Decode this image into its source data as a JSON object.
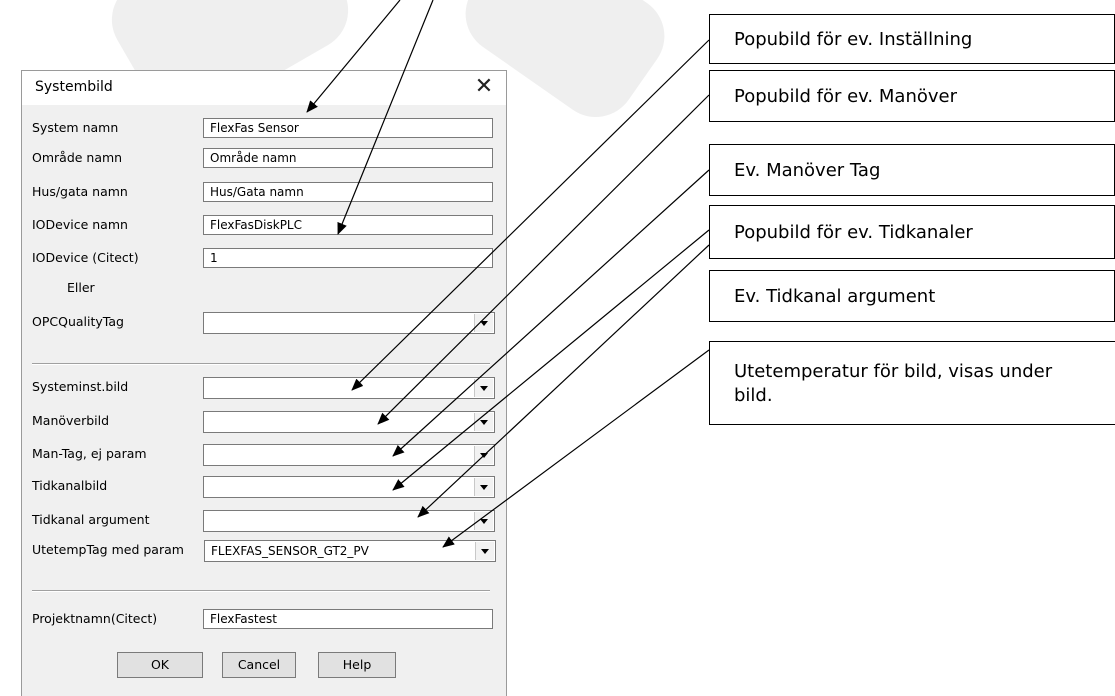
{
  "dialog": {
    "title": "Systembild",
    "close_glyph": "✕",
    "labels": {
      "system_name": "System namn",
      "area_name": "Område namn",
      "building_name": "Hus/gata namn",
      "iodevice_name": "IODevice namn",
      "iodevice_citect": "IODevice (Citect)",
      "or": "Eller",
      "opc_quality_tag": "OPCQualityTag",
      "settings_image": "Systeminst.bild",
      "maneuver_image": "Manöverbild",
      "maneuver_tag": "Man-Tag, ej param",
      "timechannel_image": "Tidkanalbild",
      "timechannel_arg": "Tidkanal argument",
      "outdoor_temp_tag": "UtetempTag med param",
      "project_name": "Projektnamn(Citect)"
    },
    "values": {
      "system_name": "FlexFas Sensor",
      "area_name": "Område namn",
      "building_name": "Hus/Gata namn",
      "iodevice_name": "FlexFasDiskPLC",
      "iodevice_citect": "1",
      "opc_quality_tag": "",
      "settings_image": "",
      "maneuver_image": "",
      "maneuver_tag": "",
      "timechannel_image": "",
      "timechannel_arg": "",
      "outdoor_temp_tag": "FLEXFAS_SENSOR_GT2_PV",
      "project_name": "FlexFastest"
    },
    "buttons": {
      "ok": "OK",
      "cancel": "Cancel",
      "help": "Help"
    }
  },
  "callouts": [
    "Popubild för ev. Inställning",
    "Popubild för ev. Manöver",
    "Ev. Manöver Tag",
    "Popubild för ev. Tidkanaler",
    "Ev. Tidkanal argument",
    "Utetemperatur för bild, visas under bild."
  ]
}
